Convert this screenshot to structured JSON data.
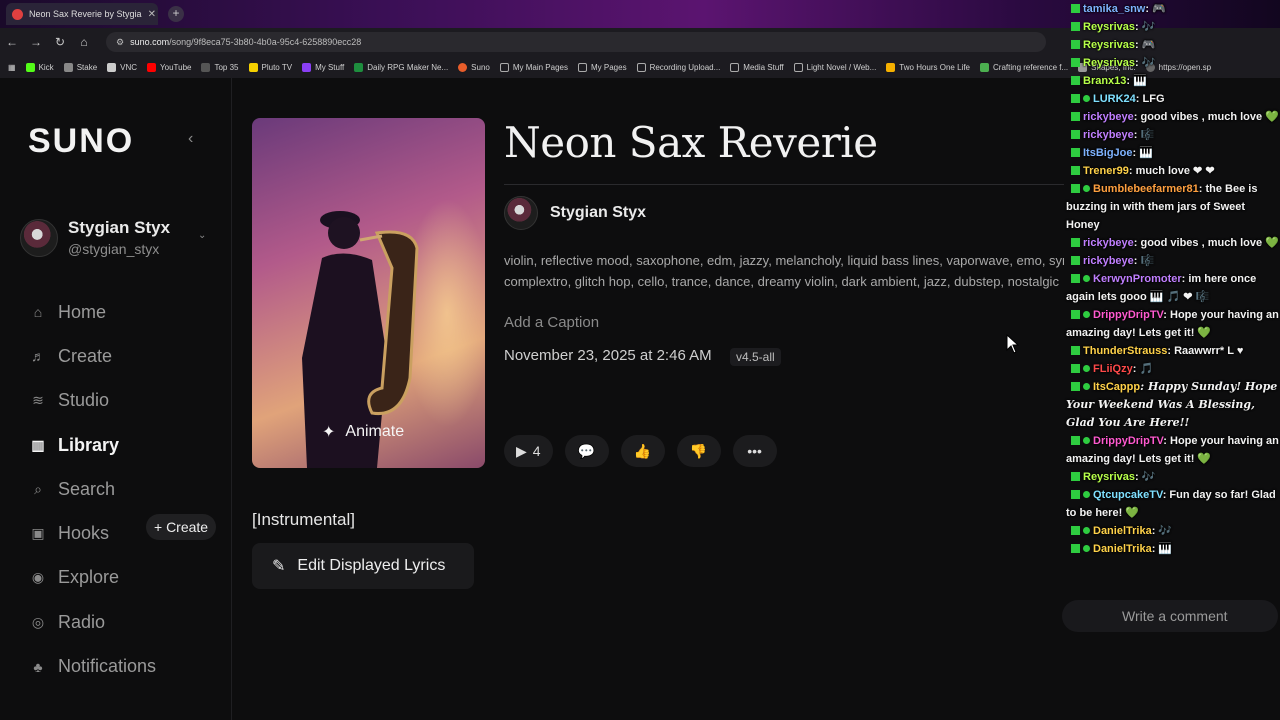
{
  "browser": {
    "tab_title": "Neon Sax Reverie by Stygia",
    "tab_close": "✕",
    "new_tab": "+",
    "url_host": "suno.com",
    "url_path": "/song/9f8eca75-3b80-4b0a-95c4-6258890ecc28",
    "bookmarks": [
      "Kick",
      "Stake",
      "VNC",
      "YouTube",
      "Top 35",
      "Pluto TV",
      "My Stuff",
      "Daily RPG Maker Ne...",
      "Suno",
      "My Main Pages",
      "My Pages",
      "Recording Upload...",
      "Media Stuff",
      "Light Novel / Web...",
      "Two Hours One Life",
      "Crafting reference f...",
      "Shapes, Inc.",
      "https://open.sp"
    ]
  },
  "sidebar": {
    "logo": "SUNO",
    "user_name": "Stygian Styx",
    "user_handle": "@stygian_styx",
    "nav": [
      {
        "label": "Home",
        "icon": "⌂"
      },
      {
        "label": "Create",
        "icon": "♬"
      },
      {
        "label": "Studio",
        "icon": "≋"
      },
      {
        "label": "Library",
        "icon": "▥"
      },
      {
        "label": "Search",
        "icon": "⌕"
      },
      {
        "label": "Hooks",
        "icon": "▣"
      },
      {
        "label": "Explore",
        "icon": "◉"
      },
      {
        "label": "Radio",
        "icon": "◎"
      },
      {
        "label": "Notifications",
        "icon": "♣"
      }
    ],
    "hooks_create": "+ Create"
  },
  "song": {
    "title": "Neon Sax Reverie",
    "artist": "Stygian Styx",
    "tags_line1": "violin, reflective mood, saxophone, edm, jazzy, melancholy, liquid bass lines, vaporwave, emo, synthwave, harmony, blues, nostalgic ur",
    "tags_line2": "complextro, glitch hop, cello, trance, dance, dreamy violin, dark ambient, jazz, dubstep, nostalgic",
    "caption_placeholder": "Add a Caption",
    "date": "November 23, 2025 at 2:46 AM",
    "version": "v4.5-all",
    "animate_label": "Animate",
    "play_count": "4",
    "lyrics": "[Instrumental]",
    "edit_lyrics": "Edit Displayed Lyrics"
  },
  "chat": {
    "input_placeholder": "Write a comment",
    "messages": [
      {
        "user": "tamika_snw",
        "color": "#7fb3ff",
        "text": ": 🎮"
      },
      {
        "user": "Reysrivas",
        "color": "#b7ff4a",
        "text": ": 🎶"
      },
      {
        "user": "Reysrivas",
        "color": "#b7ff4a",
        "text": ": 🎮"
      },
      {
        "user": "Reysrivas",
        "color": "#b7ff4a",
        "text": ": 🎶"
      },
      {
        "user": "Branx13",
        "color": "#b7ff4a",
        "text": ": 🎹"
      },
      {
        "user": "LURK24",
        "color": "#7fe0ff",
        "text": ": LFG",
        "badge": true
      },
      {
        "user": "rickybeye",
        "color": "#c07fff",
        "text": ": good vibes , much love 💚"
      },
      {
        "user": "rickybeye",
        "color": "#c07fff",
        "text": ": 🎼"
      },
      {
        "user": "ItsBigJoe",
        "color": "#7fb3ff",
        "text": ": 🎹"
      },
      {
        "user": "Trener99",
        "color": "#ffd24a",
        "text": ": much love ❤ ❤"
      },
      {
        "user": "Bumblebeefarmer81",
        "color": "#ffa040",
        "text": ": the Bee is buzzing in with them jars of Sweet Honey",
        "badge": true
      },
      {
        "user": "rickybeye",
        "color": "#c07fff",
        "text": ": good vibes , much love 💚"
      },
      {
        "user": "rickybeye",
        "color": "#c07fff",
        "text": ": 🎼"
      },
      {
        "user": "KerwynPromoter",
        "color": "#c07fff",
        "text": ": im here once again lets gooo 🎹 🎵 ❤ 🎼",
        "badge": true
      },
      {
        "user": "DrippyDripTV",
        "color": "#ff5ad0",
        "text": ": Hope your having an amazing day! Lets get it! 💚",
        "badge": true
      },
      {
        "user": "ThunderStrauss",
        "color": "#ffd24a",
        "text": ": Raawwrr* L ♥"
      },
      {
        "user": "FLiiQzy",
        "color": "#ff4a4a",
        "text": ": 🎵",
        "badge": true
      },
      {
        "user": "ItsCappp",
        "color": "#ffd24a",
        "text": ": Happy Sunday! Hope Your Weekend Was A Blessing, Glad You Are Here!!",
        "badge": true,
        "cursive": true
      },
      {
        "user": "DrippyDripTV",
        "color": "#ff5ad0",
        "text": ": Hope your having an amazing day! Lets get it! 💚",
        "badge": true
      },
      {
        "user": "Reysrivas",
        "color": "#b7ff4a",
        "text": ": 🎶"
      },
      {
        "user": "QtcupcakeTV",
        "color": "#7fe0ff",
        "text": ": Fun day so far! Glad to be here! 💚",
        "badge": true
      },
      {
        "user": "DanielTrika",
        "color": "#ffd24a",
        "text": ": 🎶",
        "badge": true
      },
      {
        "user": "DanielTrika",
        "color": "#ffd24a",
        "text": ": 🎹",
        "badge": true
      }
    ]
  }
}
